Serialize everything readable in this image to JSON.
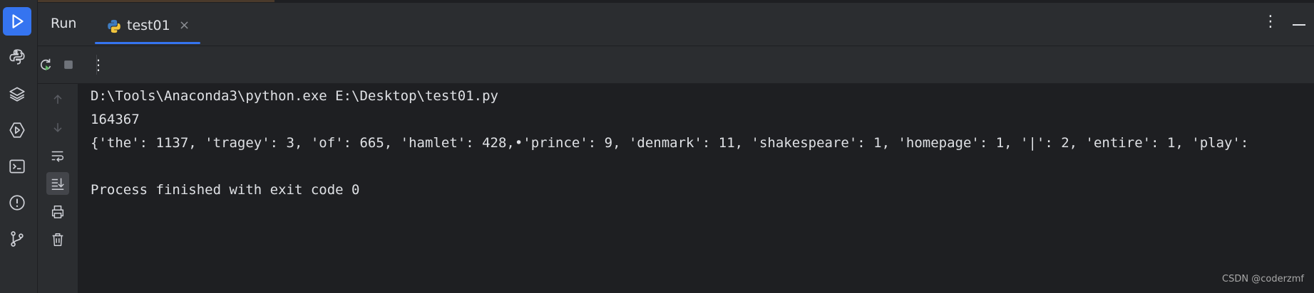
{
  "left_rail": {
    "items": [
      {
        "icon": "run-icon",
        "active": true
      },
      {
        "icon": "python-console-icon"
      },
      {
        "icon": "layers-icon"
      },
      {
        "icon": "services-icon"
      },
      {
        "icon": "terminal-icon"
      },
      {
        "icon": "problems-icon"
      },
      {
        "icon": "git-icon"
      }
    ]
  },
  "header": {
    "panel_title": "Run",
    "tab": {
      "label": "test01",
      "close": "×"
    },
    "more": "⋮"
  },
  "toolbar": {
    "rerun_icon": "rerun-icon",
    "stop_icon": "stop-icon",
    "more": "⋮"
  },
  "gutter": {
    "items": [
      "arrow-up-icon",
      "arrow-down-icon",
      "soft-wrap-icon",
      "scroll-to-end-icon",
      "print-icon",
      "trash-icon"
    ]
  },
  "console": {
    "lines": [
      "D:\\Tools\\Anaconda3\\python.exe E:\\Desktop\\test01.py",
      "164367",
      "{'the': 1137, 'tragey': 3, 'of': 665, 'hamlet': 428,•'prince': 9, 'denmark': 11, 'shakespeare': 1, 'homepage': 1, '|': 2, 'entire': 1, 'play':",
      "",
      "Process finished with exit code 0"
    ]
  },
  "watermark": "CSDN @coderzmf",
  "colors": {
    "accent": "#3574f0",
    "background": "#1e1f22",
    "panel": "#2b2d30",
    "text": "#dfe1e5"
  }
}
